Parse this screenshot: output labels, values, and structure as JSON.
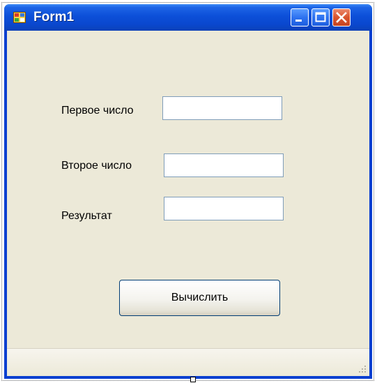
{
  "window": {
    "title": "Form1",
    "controls": {
      "minimize": "minimize-icon",
      "maximize": "maximize-icon",
      "close": "close-icon"
    }
  },
  "form": {
    "fields": [
      {
        "label": "Первое число",
        "value": ""
      },
      {
        "label": "Второе число",
        "value": ""
      },
      {
        "label": "Результат",
        "value": ""
      }
    ],
    "compute_button": "Вычислить"
  },
  "colors": {
    "titlebar": "#0c4fd8",
    "client": "#ece9d8",
    "close_button": "#d9542d"
  }
}
